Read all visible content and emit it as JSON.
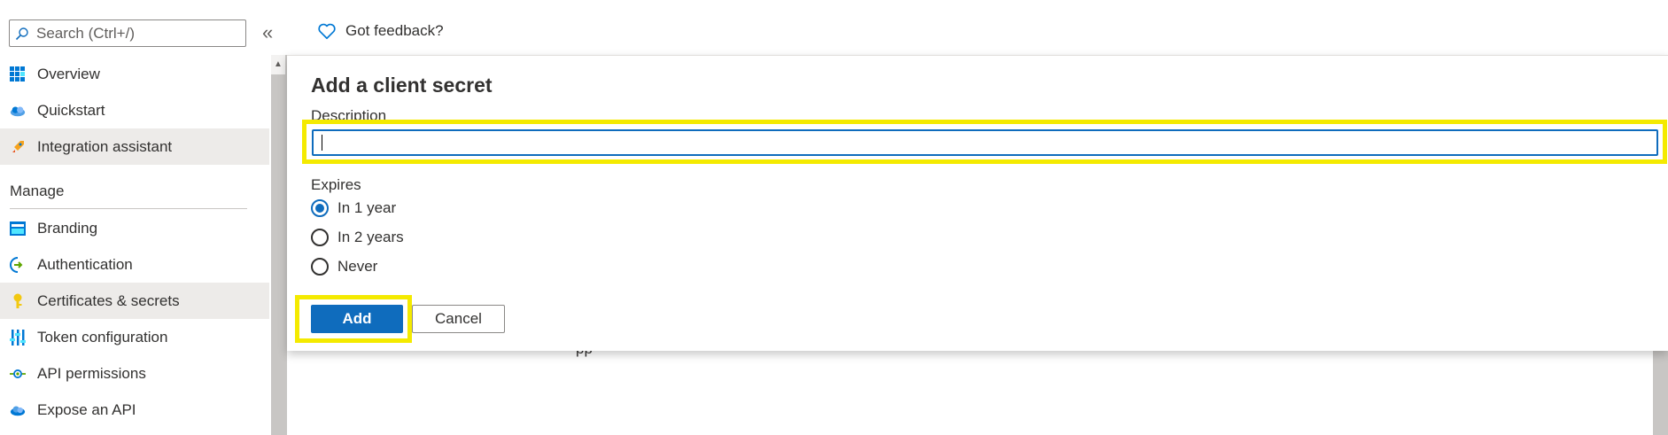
{
  "search": {
    "placeholder": "Search (Ctrl+/)"
  },
  "collapse_label": "«",
  "header": {
    "feedback_label": "Got feedback?"
  },
  "sidebar": {
    "items": [
      {
        "label": "Overview",
        "icon": "grid-icon"
      },
      {
        "label": "Quickstart",
        "icon": "cloud-icon"
      },
      {
        "label": "Integration assistant",
        "icon": "rocket-icon"
      }
    ],
    "manage_title": "Manage",
    "manage_items": [
      {
        "label": "Branding",
        "icon": "branding-icon"
      },
      {
        "label": "Authentication",
        "icon": "authentication-icon"
      },
      {
        "label": "Certificates & secrets",
        "icon": "key-icon"
      },
      {
        "label": "Token configuration",
        "icon": "token-icon"
      },
      {
        "label": "API permissions",
        "icon": "api-permissions-icon"
      },
      {
        "label": "Expose an API",
        "icon": "expose-api-icon"
      }
    ]
  },
  "dialog": {
    "title": "Add a client secret",
    "description_label": "Description",
    "description_value": "",
    "expires_label": "Expires",
    "options": [
      "In 1 year",
      "In 2 years",
      "Never"
    ],
    "selected_option": "In 1 year",
    "add_label": "Add",
    "cancel_label": "Cancel"
  },
  "background_fragment": "pp",
  "colors": {
    "accent": "#0f6cbd",
    "highlight": "#f4ea00",
    "selected_bg": "#edebe9"
  }
}
